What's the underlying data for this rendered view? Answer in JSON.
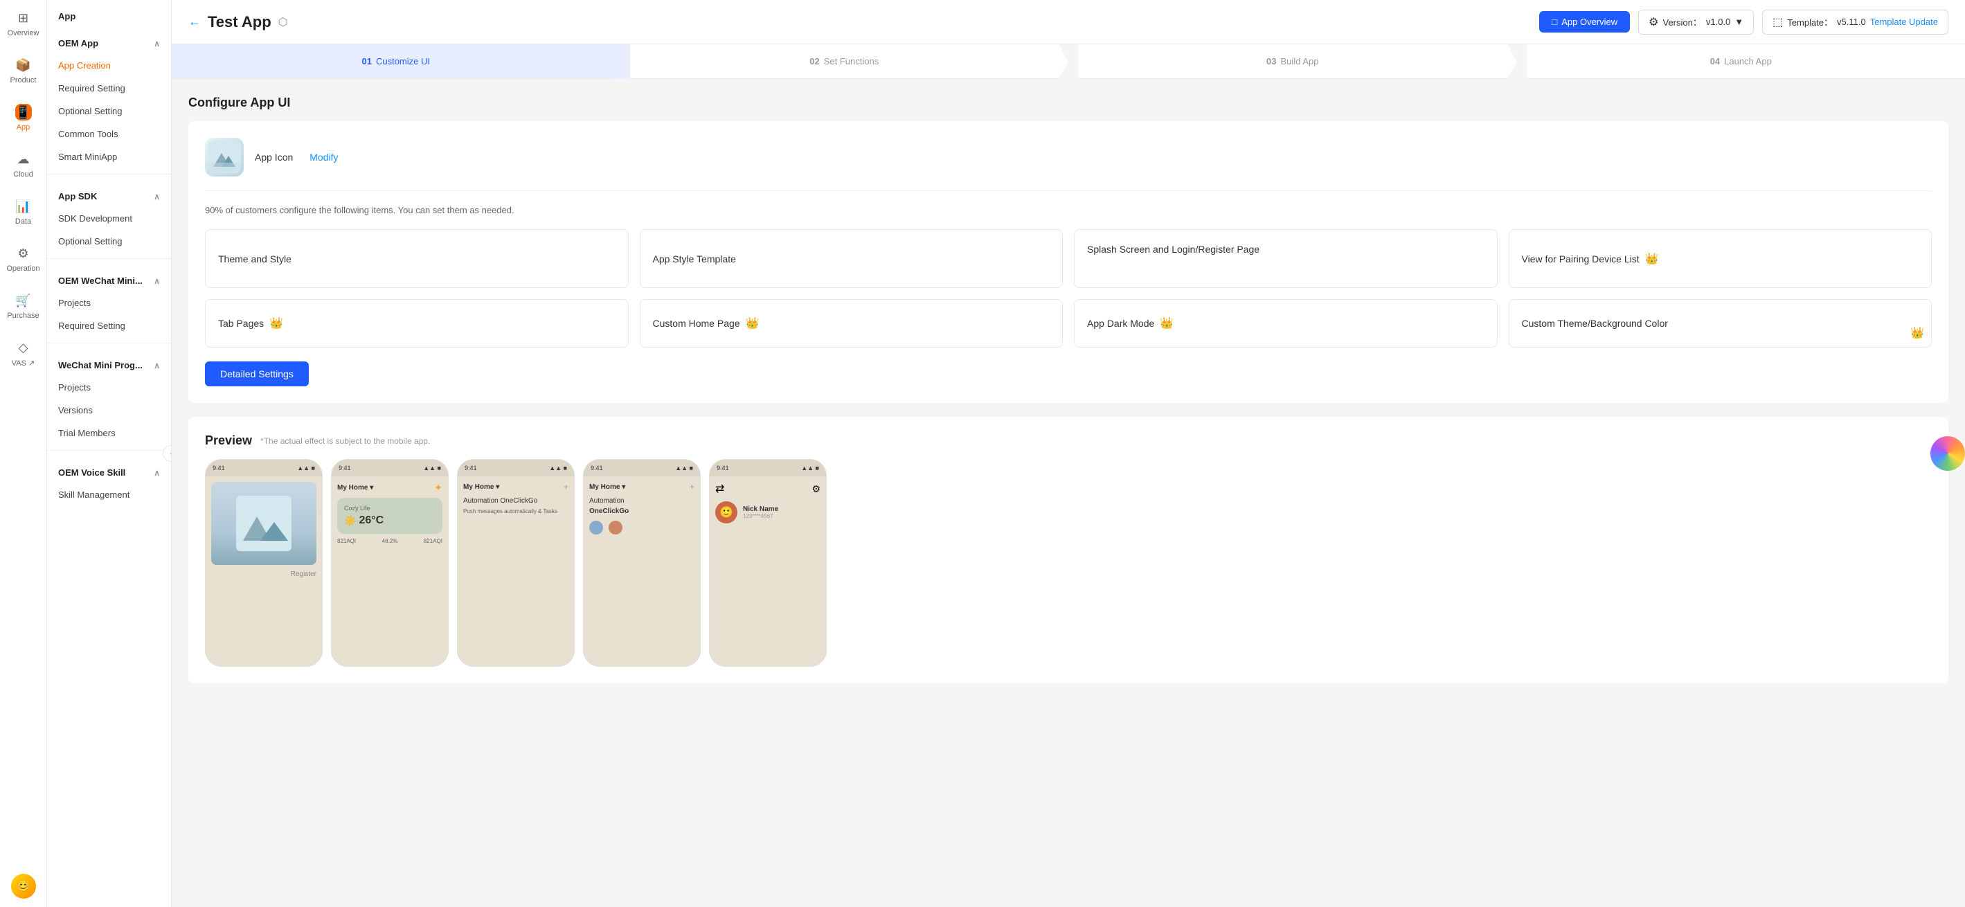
{
  "sidebar": {
    "icons": [
      {
        "id": "overview",
        "label": "Overview",
        "icon": "⊞",
        "active": false
      },
      {
        "id": "product",
        "label": "Product",
        "icon": "📦",
        "active": false
      },
      {
        "id": "app",
        "label": "App",
        "icon": "📱",
        "active": true
      },
      {
        "id": "cloud",
        "label": "Cloud",
        "icon": "☁",
        "active": false
      },
      {
        "id": "data",
        "label": "Data",
        "icon": "📊",
        "active": false
      },
      {
        "id": "operation",
        "label": "Operation",
        "icon": "⚙",
        "active": false
      },
      {
        "id": "purchase",
        "label": "Purchase",
        "icon": "🛒",
        "active": false
      },
      {
        "id": "vas",
        "label": "VAS ↗",
        "icon": "◇",
        "active": false
      }
    ]
  },
  "nav": {
    "oem_app": {
      "header": "OEM App",
      "items": [
        {
          "id": "app-creation",
          "label": "App Creation",
          "active": true
        },
        {
          "id": "required-setting",
          "label": "Required Setting",
          "active": false
        },
        {
          "id": "optional-setting",
          "label": "Optional Setting",
          "active": false
        },
        {
          "id": "common-tools",
          "label": "Common Tools",
          "active": false
        },
        {
          "id": "smart-miniapp",
          "label": "Smart MiniApp",
          "active": false
        }
      ]
    },
    "app_sdk": {
      "header": "App SDK",
      "items": [
        {
          "id": "sdk-development",
          "label": "SDK Development",
          "active": false
        },
        {
          "id": "sdk-optional",
          "label": "Optional Setting",
          "active": false
        }
      ]
    },
    "oem_wechat": {
      "header": "OEM WeChat Mini...",
      "items": [
        {
          "id": "wechat-projects",
          "label": "Projects",
          "active": false
        },
        {
          "id": "wechat-required",
          "label": "Required Setting",
          "active": false
        }
      ]
    },
    "wechat_prog": {
      "header": "WeChat Mini Prog...",
      "items": [
        {
          "id": "prog-projects",
          "label": "Projects",
          "active": false
        },
        {
          "id": "prog-versions",
          "label": "Versions",
          "active": false
        },
        {
          "id": "prog-trial",
          "label": "Trial Members",
          "active": false
        }
      ]
    },
    "oem_voice": {
      "header": "OEM Voice Skill",
      "items": [
        {
          "id": "skill-management",
          "label": "Skill Management",
          "active": false
        }
      ]
    }
  },
  "header": {
    "back_label": "←",
    "app_title": "Test App",
    "dropdown_icon": "⬡",
    "app_overview_label": "App Overview",
    "app_overview_icon": "□",
    "version_label": "Version：",
    "version_value": "v1.0.0",
    "version_dropdown": "▼",
    "template_label": "Template：",
    "template_value": "v5.11.0",
    "template_update": "Template Update"
  },
  "steps": [
    {
      "num": "01",
      "label": "Customize UI",
      "active": true
    },
    {
      "num": "02",
      "label": "Set Functions",
      "active": false
    },
    {
      "num": "03",
      "label": "Build App",
      "active": false
    },
    {
      "num": "04",
      "label": "Launch App",
      "active": false
    }
  ],
  "page": {
    "title": "Configure App UI",
    "app_icon_label": "App Icon",
    "modify_label": "Modify",
    "config_note": "90% of customers configure the following items. You can set them as needed.",
    "options": [
      {
        "id": "theme-style",
        "label": "Theme and Style",
        "crown": false
      },
      {
        "id": "app-style-template",
        "label": "App Style Template",
        "crown": false
      },
      {
        "id": "splash-login",
        "label": "Splash Screen and Login/Register Page",
        "crown": false
      },
      {
        "id": "view-pairing",
        "label": "View for Pairing Device List",
        "crown": true
      },
      {
        "id": "tab-pages",
        "label": "Tab Pages",
        "crown": true
      },
      {
        "id": "custom-home",
        "label": "Custom Home Page",
        "crown": true
      },
      {
        "id": "app-dark-mode",
        "label": "App Dark Mode",
        "crown": true
      },
      {
        "id": "custom-theme-bg",
        "label": "Custom Theme/Background Color",
        "crown": true
      }
    ],
    "detailed_settings_label": "Detailed Settings",
    "preview_title": "Preview",
    "preview_note": "*The actual effect is subject to the mobile app."
  },
  "phones": [
    {
      "id": "phone1",
      "status_time": "9:41",
      "bg_color": "#f0ebe0",
      "content_type": "register"
    },
    {
      "id": "phone2",
      "status_time": "9:41",
      "bg_color": "#f0ebe0",
      "content_type": "home",
      "temp": "26°C",
      "label": "My Home"
    },
    {
      "id": "phone3",
      "status_time": "9:41",
      "bg_color": "#f0ebe0",
      "content_type": "automation",
      "label": "My Home"
    },
    {
      "id": "phone4",
      "status_time": "9:41",
      "bg_color": "#f0ebe0",
      "content_type": "automation2",
      "label": "My Home"
    },
    {
      "id": "phone5",
      "status_time": "9:41",
      "bg_color": "#f0ebe0",
      "content_type": "profile",
      "label": "Nick Name"
    }
  ]
}
